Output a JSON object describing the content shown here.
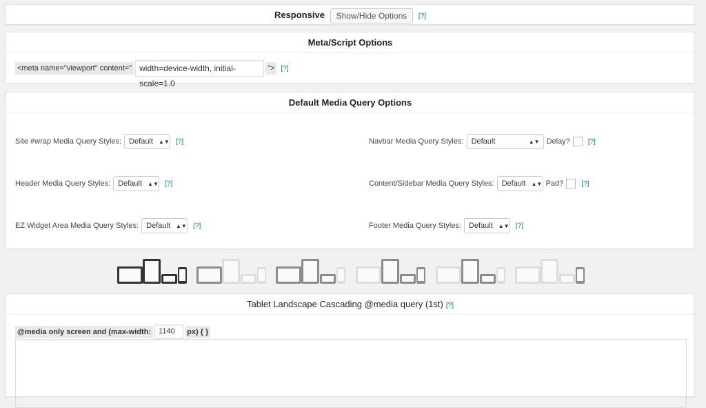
{
  "responsive": {
    "label": "Responsive",
    "button": "Show/Hide Options",
    "help": "[?]"
  },
  "meta": {
    "title": "Meta/Script Options",
    "prefix": "<meta name=\"viewport\" content=\"",
    "value": "width=device-width, initial-scale=1.0",
    "suffix": "\">",
    "help": "[?]"
  },
  "mq": {
    "title": "Default Media Query Options",
    "items": [
      {
        "label": "Site #wrap Media Query Styles:",
        "value": "Default",
        "help": "[?]"
      },
      {
        "label": "Navbar Media Query Styles:",
        "value": "Default",
        "extra": "Delay?",
        "help": "[?]"
      },
      {
        "label": "Header Media Query Styles:",
        "value": "Default",
        "help": "[?]"
      },
      {
        "label": "Content/Sidebar Media Query Styles:",
        "value": "Default",
        "extra": "Pad?",
        "help": "[?]"
      },
      {
        "label": "EZ Widget Area Media Query Styles:",
        "value": "Default",
        "help": "[?]"
      },
      {
        "label": "Footer Media Query Styles:",
        "value": "Default",
        "help": "[?]"
      }
    ]
  },
  "device_tabs": [
    {
      "name": "tablet-landscape",
      "selected": true,
      "states": [
        "dark",
        "dark",
        "dark",
        "dark"
      ]
    },
    {
      "name": "tab-2",
      "states": [
        "mid",
        "light",
        "light",
        "light"
      ]
    },
    {
      "name": "tab-3",
      "states": [
        "mid",
        "mid",
        "mid",
        "light"
      ]
    },
    {
      "name": "tab-4",
      "states": [
        "light",
        "mid",
        "mid",
        "mid"
      ]
    },
    {
      "name": "tab-5",
      "states": [
        "light",
        "mid",
        "mid",
        "light"
      ]
    },
    {
      "name": "tab-6",
      "states": [
        "light",
        "light",
        "light",
        "mid"
      ]
    }
  ],
  "tablet": {
    "title": "Tablet Landscape Cascading @media query (1st)",
    "help": "[?]",
    "prefix": "@media only screen and (max-width:",
    "value": "1140",
    "suffix": "px) { }",
    "css": ""
  },
  "colors": {
    "dark": "#333333",
    "mid": "#8c8c8c",
    "light": "#dddddd",
    "link": "#0073aa"
  }
}
